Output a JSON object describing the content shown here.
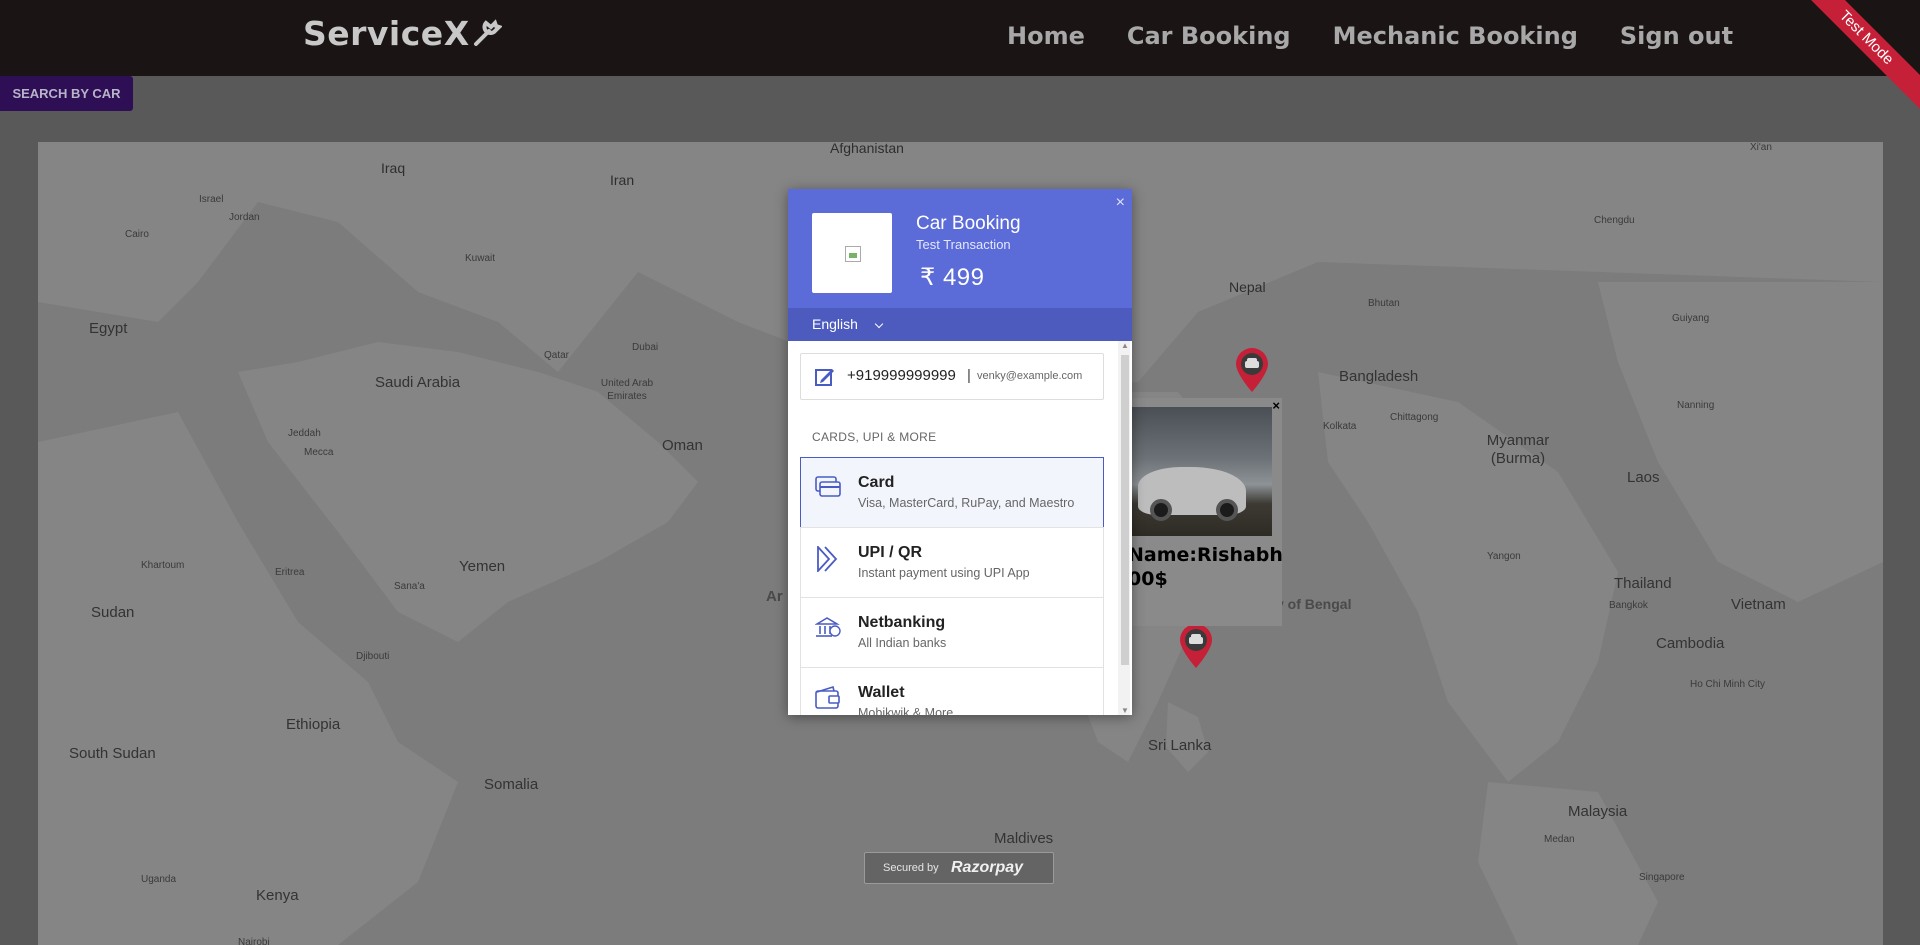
{
  "navbar": {
    "brand": "ServiceX",
    "links": [
      "Home",
      "Car Booking",
      "Mechanic Booking",
      "Sign out"
    ],
    "ribbon": "Test Mode"
  },
  "search_button": "SEARCH BY CAR",
  "map": {
    "labels": {
      "afghanistan": "Afghanistan",
      "iraq": "Iraq",
      "iran": "Iran",
      "israel": "Israel",
      "jordan": "Jordan",
      "cairo": "Cairo",
      "kuwait": "Kuwait",
      "egypt": "Egypt",
      "saudi_arabia": "Saudi Arabia",
      "qatar": "Qatar",
      "dubai": "Dubai",
      "uae": "United Arab Emirates",
      "oman": "Oman",
      "jeddah": "Jeddah",
      "mecca": "Mecca",
      "yemen": "Yemen",
      "khartoum": "Khartoum",
      "eritrea": "Eritrea",
      "sana": "Sana'a",
      "sudan": "Sudan",
      "djibouti": "Djibouti",
      "ethiopia": "Ethiopia",
      "south_sudan": "South Sudan",
      "somalia": "Somalia",
      "uganda": "Uganda",
      "kenya": "Kenya",
      "nairobi": "Nairobi",
      "nepal": "Nepal",
      "bhutan": "Bhutan",
      "bangladesh": "Bangladesh",
      "kolkata": "Kolkata",
      "chittagong": "Chittagong",
      "myanmar": "Myanmar (Burma)",
      "laos": "Laos",
      "thailand": "Thailand",
      "bangkok": "Bangkok",
      "vietnam": "Vietnam",
      "cambodia": "Cambodia",
      "hcmc": "Ho Chi Minh City",
      "yangon": "Yangon",
      "sri_lanka": "Sri Lanka",
      "maldives": "Maldives",
      "malaysia": "Malaysia",
      "medan": "Medan",
      "singapore": "Singapore",
      "chengdu": "Chengdu",
      "guiyang": "Guiyang",
      "nanning": "Nanning",
      "xian": "Xi'an",
      "bay_of_bengal": "y of Bengal",
      "arabian": "Ar"
    }
  },
  "info_popup": {
    "close": "×",
    "line1": "Name:Rishabh",
    "line2": "00$"
  },
  "checkout": {
    "close": "×",
    "merchant_name": "Car Booking",
    "description": "Test Transaction",
    "amount": "₹ 499",
    "language": "English",
    "phone": "+919999999999",
    "separator": "|",
    "email": "venky@example.com",
    "section_title": "CARDS, UPI & MORE",
    "methods": [
      {
        "title": "Card",
        "subtitle": "Visa, MasterCard, RuPay, and Maestro"
      },
      {
        "title": "UPI / QR",
        "subtitle": "Instant payment using UPI App"
      },
      {
        "title": "Netbanking",
        "subtitle": "All Indian banks"
      },
      {
        "title": "Wallet",
        "subtitle": "Mobikwik & More"
      }
    ]
  },
  "secured": {
    "text": "Secured by",
    "brand": "Razorpay"
  },
  "colors": {
    "navbar": "#1a1414",
    "checkout_header": "#5b6bd8",
    "pin": "#c62038",
    "ribbon": "#c62038"
  }
}
